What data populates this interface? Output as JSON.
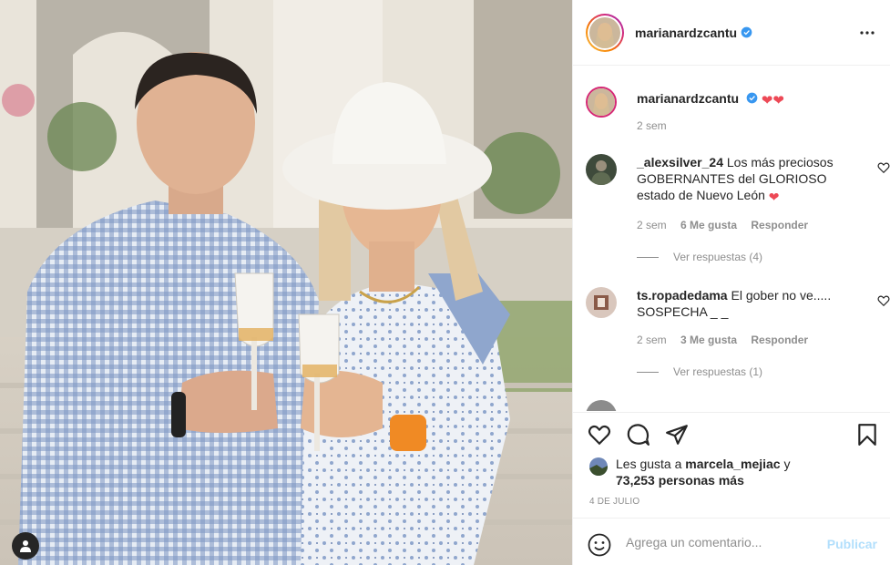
{
  "post": {
    "username": "marianardzcantu",
    "caption_time": "2 sem",
    "caption_emoji": "❤❤"
  },
  "comments": [
    {
      "username": "_alexsilver_24",
      "text": "Los más preciosos GOBERNANTES del GLORIOSO estado de Nuevo León",
      "emoji": "❤",
      "time": "2 sem",
      "likes": "6 Me gusta",
      "reply": "Responder",
      "view_replies": "Ver respuestas (4)"
    },
    {
      "username": "ts.ropadedama",
      "text": "El gober no ve..... SOSPECHA _ _",
      "time": "2 sem",
      "likes": "3 Me gusta",
      "reply": "Responder",
      "view_replies": "Ver respuestas (1)"
    }
  ],
  "likes": {
    "prefix": "Les gusta a",
    "user": "marcela_mejiac",
    "connector": "y",
    "count": "73,253 personas más"
  },
  "date": "4 DE JULIO",
  "comment_box": {
    "placeholder": "Agrega un comentario...",
    "publish_label": "Publicar"
  },
  "colors": {
    "verified": "#3897f0",
    "heart": "#ed4956",
    "publish_disabled": "#b2dffc",
    "muted_text": "#8e8e8e"
  },
  "icons": [
    "like-icon",
    "comment-icon",
    "share-icon",
    "save-icon",
    "emoji-icon",
    "more-icon",
    "user-tag-icon",
    "verified-badge-icon"
  ]
}
